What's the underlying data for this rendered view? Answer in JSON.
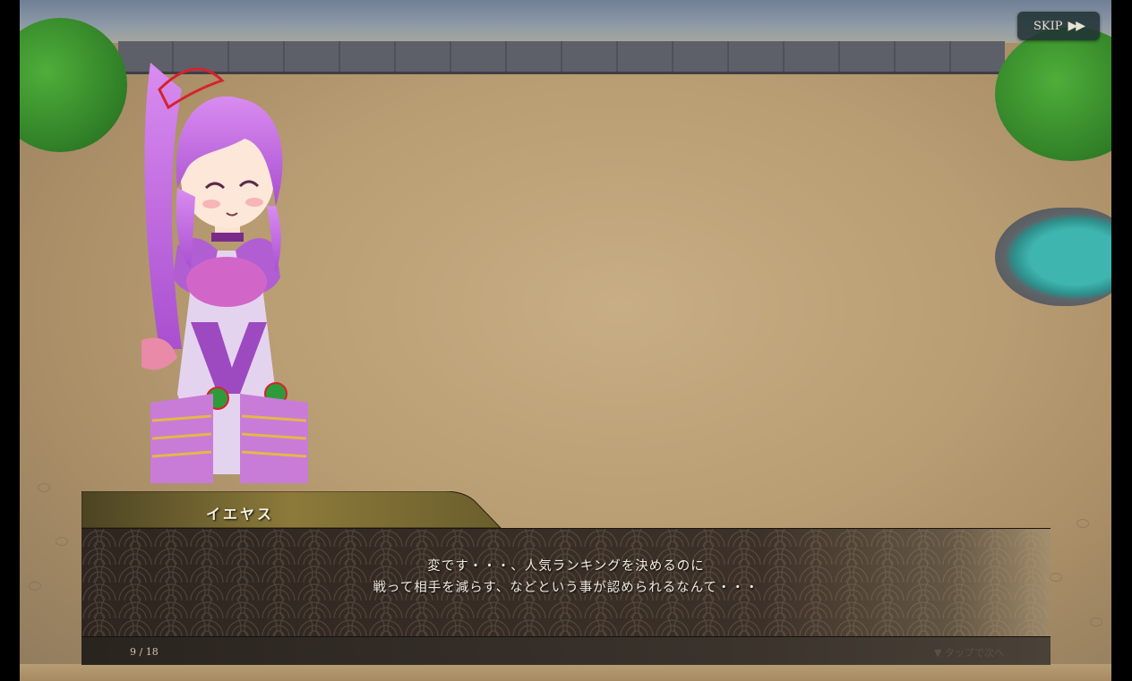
{
  "skip": {
    "label": "SKIP",
    "icon": "fast-forward-icon"
  },
  "dialogue": {
    "speaker": "イエヤス",
    "lines": [
      "変です・・・、人気ランキングを決めるのに",
      "戦って相手を減らす、などという事が認められるなんて・・・"
    ],
    "page": "9 / 18",
    "next_hint": "▼ タップで次へ"
  },
  "colors": {
    "hair": "#c56fe0",
    "armor": "#a54fc7",
    "gold": "#e2b84a",
    "dialog_bg": "#2e2620"
  }
}
